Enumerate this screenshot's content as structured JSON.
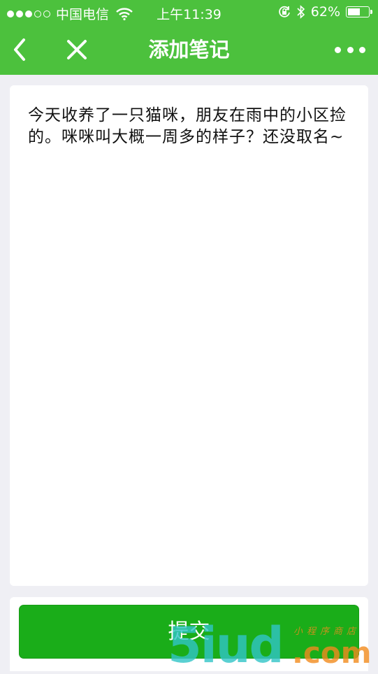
{
  "status_bar": {
    "carrier": "中国电信",
    "time": "上午11:39",
    "battery_percent": "62%",
    "battery_level": 0.62,
    "icons": [
      "signal-dots-icon",
      "wifi-icon",
      "rotation-lock-icon",
      "bluetooth-icon",
      "battery-icon"
    ]
  },
  "nav": {
    "title": "添加笔记",
    "back_icon": "chevron-left-icon",
    "close_icon": "close-icon",
    "more_icon": "more-horizontal-icon"
  },
  "note": {
    "content": "今天收养了一只猫咪，朋友在雨中的小区捡的。咪咪叫大概一周多的样子？还没取名~"
  },
  "submit": {
    "label": "提交"
  },
  "watermark": {
    "main": "5iud",
    "suffix": ".com",
    "tagline": "小程序商店"
  },
  "colors": {
    "header_bg": "#4cc13d",
    "page_bg": "#efeff4",
    "button_bg": "#1aad19"
  }
}
